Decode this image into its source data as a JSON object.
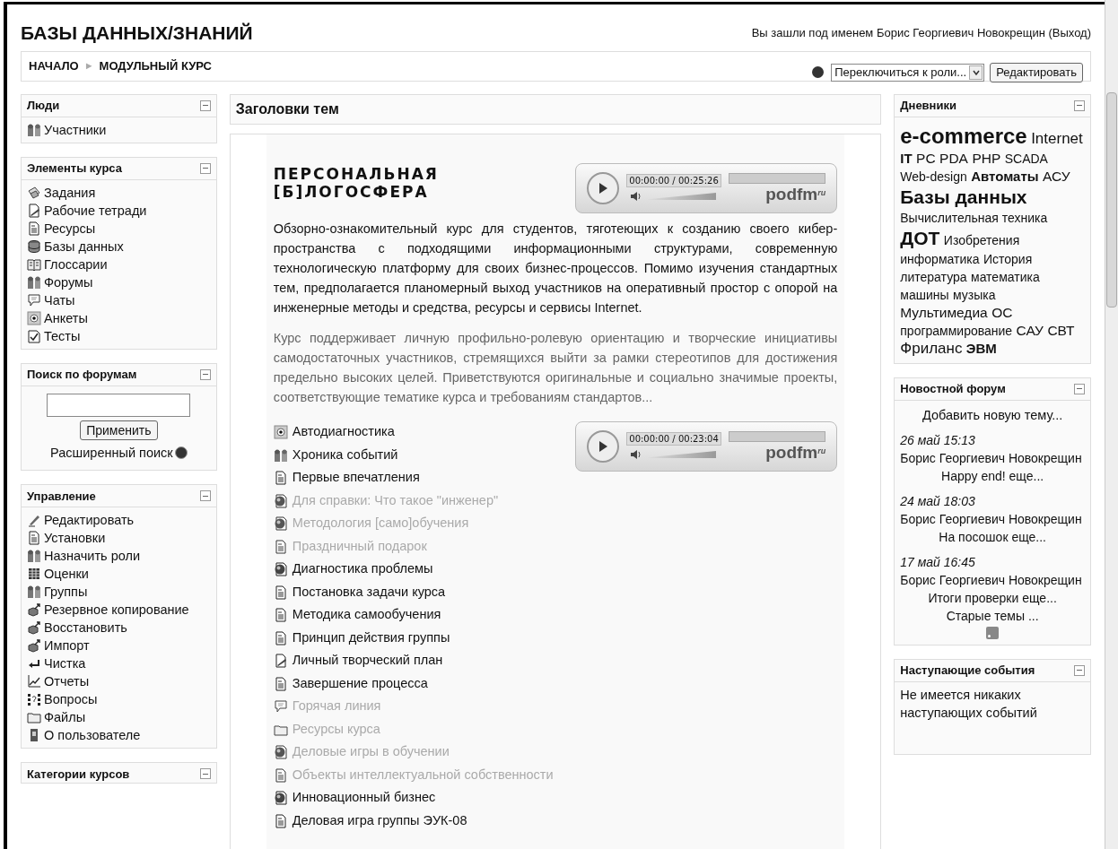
{
  "header": {
    "title": "БАЗЫ ДАННЫХ/ЗНАНИЙ",
    "login_info": "Вы зашли под именем Борис Георгиевич Новокрещин (Выход)"
  },
  "breadcrumb": [
    "НАЧАЛО",
    "►",
    "МОДУЛЬНЫЙ КУРС"
  ],
  "toolbar": {
    "role_select": "Переключиться к роли...",
    "edit_button": "Редактировать"
  },
  "left_blocks": [
    {
      "kind": "list",
      "title": "Люди",
      "items": [
        {
          "label": "Участники",
          "kind": "people"
        }
      ]
    },
    {
      "kind": "list",
      "title": "Элементы курса",
      "items": [
        {
          "label": "Задания",
          "kind": "papers"
        },
        {
          "label": "Рабочие тетради",
          "kind": "workbook"
        },
        {
          "label": "Ресурсы",
          "kind": "document"
        },
        {
          "label": "Базы данных",
          "kind": "database"
        },
        {
          "label": "Глоссарии",
          "kind": "book"
        },
        {
          "label": "Форумы",
          "kind": "people"
        },
        {
          "label": "Чаты",
          "kind": "chat"
        },
        {
          "label": "Анкеты",
          "kind": "radio"
        },
        {
          "label": "Тесты",
          "kind": "check"
        }
      ]
    },
    {
      "kind": "search",
      "title": "Поиск по форумам",
      "button": "Применить",
      "link": "Расширенный поиск"
    },
    {
      "kind": "list",
      "title": "Управление",
      "items": [
        {
          "label": "Редактировать",
          "kind": "pencil"
        },
        {
          "label": "Установки",
          "kind": "document"
        },
        {
          "label": "Назначить роли",
          "kind": "people"
        },
        {
          "label": "Оценки",
          "kind": "grid"
        },
        {
          "label": "Группы",
          "kind": "people"
        },
        {
          "label": "Резервное копирование",
          "kind": "box"
        },
        {
          "label": "Восстановить",
          "kind": "box"
        },
        {
          "label": "Импорт",
          "kind": "box"
        },
        {
          "label": "Чистка",
          "kind": "return"
        },
        {
          "label": "Отчеты",
          "kind": "chart"
        },
        {
          "label": "Вопросы",
          "kind": "question"
        },
        {
          "label": "Файлы",
          "kind": "folder"
        },
        {
          "label": "О пользователе",
          "kind": "person"
        }
      ]
    },
    {
      "kind": "cut",
      "title": "Категории курсов"
    }
  ],
  "main": {
    "section_title": "Заголовки тем",
    "course_title": [
      "ПЕРСОНАЛЬНАЯ",
      "[Б]ЛОГОСФЕРА"
    ],
    "players": [
      {
        "time": "00:00:00 / 00:25:26",
        "logo": "podfm",
        "logo_mark": "ru"
      },
      {
        "time": "00:00:00 / 00:23:04",
        "logo": "podfm",
        "logo_mark": "ru"
      }
    ],
    "description": "Обзорно-ознакомительный курс для студентов, тяготеющих к созданию своего кибер-пространства с подходящими информационными структурами, современную технологическую платформу для своих бизнес-процессов. Помимо изучения стандартных тем, предполагается планомерный выход участников на оперативный простор с опорой на инженерные методы и средства, ресурсы и сервисы Internet.",
    "note": "Курс поддерживает личную профильно-ролевую ориентацию и творческие инициативы самодостаточных участников, стремящихся выйти за рамки стереотипов для достижения предельно высоких целей. Приветствуются оригинальные и социально значимые проекты, соответствующие тематике курса и требованиям стандартов...",
    "activities": [
      {
        "label": "Автодиагностика",
        "kind": "radio",
        "dimmed": false
      },
      {
        "label": "Хроника событий",
        "kind": "people",
        "dimmed": false
      },
      {
        "label": "Первые впечатления",
        "kind": "document",
        "dimmed": false
      },
      {
        "label": "Для справки: Что такое \"инженер\"",
        "kind": "globe",
        "dimmed": true
      },
      {
        "label": "Методология [само]обучения",
        "kind": "globe",
        "dimmed": true
      },
      {
        "label": "Праздничный подарок",
        "kind": "document",
        "dimmed": true
      },
      {
        "label": "Диагностика проблемы",
        "kind": "globe",
        "dimmed": false
      },
      {
        "label": "Постановка задачи курса",
        "kind": "document",
        "dimmed": false
      },
      {
        "label": "Методика самообучения",
        "kind": "document",
        "dimmed": false
      },
      {
        "label": "Принцип действия группы",
        "kind": "document",
        "dimmed": false
      },
      {
        "label": "Личный творческий план",
        "kind": "workbook",
        "dimmed": false
      },
      {
        "label": "Завершение процесса",
        "kind": "document",
        "dimmed": false
      },
      {
        "label": "Горячая линия",
        "kind": "chat",
        "dimmed": true
      },
      {
        "label": "Ресурсы курса",
        "kind": "folder",
        "dimmed": true
      },
      {
        "label": "Деловые игры в обучении",
        "kind": "globe",
        "dimmed": true
      },
      {
        "label": "Объекты интеллектуальной собственности",
        "kind": "document",
        "dimmed": true
      },
      {
        "label": "Инновационный бизнес",
        "kind": "globe",
        "dimmed": false
      },
      {
        "label": "Деловая игра группы ЭУК-08",
        "kind": "document",
        "dimmed": false
      }
    ]
  },
  "right_blocks": {
    "blogs": {
      "title": "Дневники",
      "tags": [
        {
          "label": "e-commerce",
          "kind": "huge"
        },
        {
          "label": "Internet",
          "kind": "large"
        },
        {
          "label": "IT",
          "kind": "strong"
        },
        {
          "label": "PC",
          "kind": "medium"
        },
        {
          "label": "PDA",
          "kind": "medium"
        },
        {
          "label": "PHP",
          "kind": "medium"
        },
        {
          "label": "SCADA",
          "kind": "small"
        },
        {
          "label": "Web-design",
          "kind": "small"
        },
        {
          "label": "Автоматы",
          "kind": "strong"
        },
        {
          "label": "АСУ",
          "kind": "medium"
        },
        {
          "label": "Базы данных",
          "kind": "huge"
        },
        {
          "label": "Вычислительная техника",
          "kind": "small"
        },
        {
          "label": "ДОТ",
          "kind": "huge"
        },
        {
          "label": "Изобретения",
          "kind": "small"
        },
        {
          "label": "информатика",
          "kind": "small"
        },
        {
          "label": "История",
          "kind": "small"
        },
        {
          "label": "литература",
          "kind": "small"
        },
        {
          "label": "математика",
          "kind": "small"
        },
        {
          "label": "машины",
          "kind": "small"
        },
        {
          "label": "музыка",
          "kind": "small"
        },
        {
          "label": "Мультимедиа",
          "kind": "medium"
        },
        {
          "label": "ОС",
          "kind": "medium"
        },
        {
          "label": "программирование",
          "kind": "small"
        },
        {
          "label": "САУ",
          "kind": "medium"
        },
        {
          "label": "СВТ",
          "kind": "medium"
        },
        {
          "label": "Фриланс",
          "kind": "large"
        },
        {
          "label": "ЭВМ",
          "kind": "strong"
        }
      ]
    },
    "news": {
      "title": "Новостной форум",
      "add_link": "Добавить новую тему...",
      "posts": [
        {
          "date": "26 май 15:13",
          "author": "Борис Георгиевич Новокрещин",
          "subject": "Happy end! еще..."
        },
        {
          "date": "24 май 18:03",
          "author": "Борис Георгиевич Новокрещин",
          "subject": "На посошок еще..."
        },
        {
          "date": "17 май 16:45",
          "author": "Борис Георгиевич Новокрещин",
          "subject": "Итоги проверки еще..."
        }
      ],
      "older_link": "Старые темы ..."
    },
    "events": {
      "title": "Наступающие события",
      "text": "Не имеется никаких наступающих событий"
    }
  }
}
